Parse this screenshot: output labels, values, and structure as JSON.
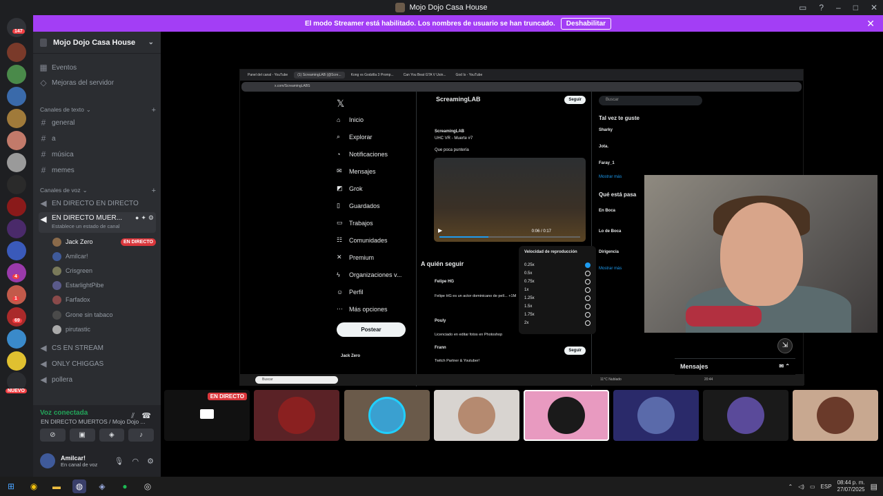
{
  "window": {
    "title": "Mojo Dojo Casa House"
  },
  "banner": {
    "text": "El modo Streamer está habilitado. Los nombres de usuario se han truncado.",
    "button": "Deshabilitar"
  },
  "guilds": {
    "badges": [
      "147",
      "4",
      "1",
      "69",
      "NUEVO"
    ]
  },
  "server": {
    "name": "Mojo Dojo Casa House",
    "menu": [
      "Eventos",
      "Mejoras del servidor"
    ],
    "text_category": "Canales de texto",
    "text_channels": [
      "general",
      "a",
      "música",
      "memes"
    ],
    "voice_category": "Canales de voz",
    "voice_channels": {
      "first": "EN DIRECTO EN DIRECTO",
      "active": "EN DIRECTO MUER...",
      "active_status": "Establece un estado de canal",
      "after": [
        "CS EN STREAM",
        "ONLY CHIGGAS",
        "pollera"
      ]
    },
    "voice_users": [
      {
        "name": "Jack Zero",
        "badge": "EN DIRECTO"
      },
      {
        "name": "Amilcar!"
      },
      {
        "name": "Crisgreen"
      },
      {
        "name": "EstarlightPibe"
      },
      {
        "name": "Farfadox"
      },
      {
        "name": "Grone sin tabaco"
      },
      {
        "name": "pirutastic"
      }
    ]
  },
  "voice_panel": {
    "status": "Voz conectada",
    "channel": "EN DIRECTO MUERTOS / Mojo Dojo ..."
  },
  "user_panel": {
    "name": "Amilcar!",
    "status": "En canal de voz"
  },
  "stream": {
    "browser_tabs": [
      "Panel del canal - YouTube",
      "(1) ScreamingLAB (@Scre...",
      "Kong vs Godzilla 3 Promp...",
      "Can You Beat GTA V Usin...",
      "God Is - YouTube"
    ],
    "url": "x.com/ScreamingLABS",
    "x_nav": [
      "Inicio",
      "Explorar",
      "Notificaciones",
      "Mensajes",
      "Grok",
      "Guardados",
      "Trabajos",
      "Comunidades",
      "Premium",
      "Organizaciones v...",
      "Perfil",
      "Más opciones"
    ],
    "post_button": "Postear",
    "profile_name": "ScreamingLAB",
    "follow": "Seguir",
    "tweet_name": "ScreamingLAB",
    "tweet_sub": "UHC VR - Muerte #7",
    "tweet_text": "Que poca puntería",
    "follow_title": "A quién seguir",
    "follow_people": [
      {
        "name": "Felipe HG",
        "desc": "Felipe HG es un actor dominicano de pelí... +1M"
      },
      {
        "name": "Pouly",
        "desc": "Licenciado en editar fotos en Photoshop"
      },
      {
        "name": "Frann",
        "desc": "Twitch Partner & Youtuber!"
      }
    ],
    "account": "Jack Zero",
    "search_placeholder": "Buscar",
    "suggest_title": "Tal vez te guste",
    "suggest": [
      "Sharky",
      "Jota.",
      "Faray_1"
    ],
    "show_more": "Mostrar más",
    "trending_title": "Qué está pasa",
    "trends": [
      "En Boca",
      "Lo de Boca",
      "Dirigencia"
    ],
    "speed_title": "Velocidad de reproducción",
    "speeds": [
      "0.25x",
      "0.5x",
      "0.75x",
      "1x",
      "1.25x",
      "1.5x",
      "1.75x",
      "2x"
    ],
    "selected_speed": "0.25x",
    "video_time": "0:06 / 0:17",
    "messages": "Mensajes",
    "taskbar_search": "Buscar",
    "weather": "11°C Nublado",
    "stream_clock": "20:44"
  },
  "tiles": {
    "live_label": "EN DIRECTO"
  },
  "taskbar": {
    "lang": "ESP",
    "time": "08:44 p. m.",
    "date": "27/07/2025"
  }
}
